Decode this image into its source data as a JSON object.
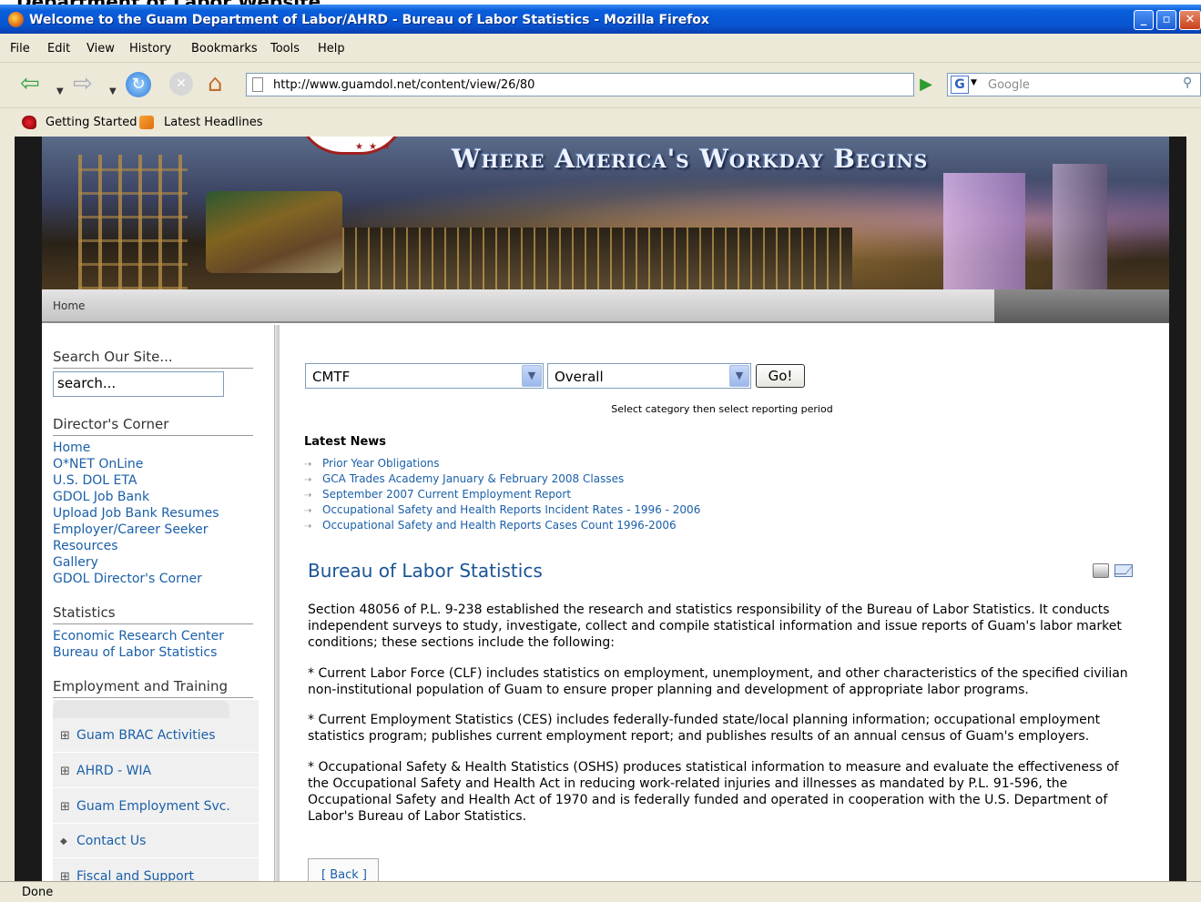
{
  "window": {
    "behind_title": "Department of Labor Website",
    "title": "Welcome to the Guam Department of Labor/AHRD - Bureau of Labor Statistics - Mozilla Firefox"
  },
  "menu": [
    "File",
    "Edit",
    "View",
    "History",
    "Bookmarks",
    "Tools",
    "Help"
  ],
  "toolbar": {
    "url": "http://www.guamdol.net/content/view/26/80",
    "search_placeholder": "Google"
  },
  "bookmarks": [
    "Getting Started",
    "Latest Headlines"
  ],
  "banner": {
    "slogan": "Where America's Workday Begins"
  },
  "breadcrumb": "Home",
  "sidebar": {
    "search_heading": "Search Our Site...",
    "search_value": "search...",
    "directors_heading": "Director's Corner",
    "directors_links": [
      "Home",
      "O*NET OnLine",
      "U.S. DOL ETA",
      "GDOL Job Bank",
      "Upload Job Bank Resumes",
      "Employer/Career Seeker",
      "Resources",
      "Gallery",
      "GDOL Director's Corner"
    ],
    "statistics_heading": "Statistics",
    "statistics_links": [
      "Economic Research Center",
      "Bureau of Labor Statistics"
    ],
    "employment_heading": "Employment and Training",
    "employment_menu": [
      {
        "marker": "⊞",
        "label": "Guam BRAC Activities"
      },
      {
        "marker": "⊞",
        "label": "AHRD - WIA"
      },
      {
        "marker": "⊞",
        "label": "Guam Employment Svc."
      },
      {
        "marker": "◆",
        "label": "Contact Us"
      },
      {
        "marker": "⊞",
        "label": "Fiscal and Support"
      }
    ]
  },
  "main": {
    "category_value": "CMTF",
    "period_value": "Overall",
    "go_label": "Go!",
    "hint": "Select category then select reporting period",
    "latest_news_heading": "Latest News",
    "news": [
      "Prior Year Obligations",
      "GCA Trades Academy January & February 2008 Classes",
      "September 2007 Current Employment Report",
      "Occupational Safety and Health Reports Incident Rates - 1996 - 2006",
      "Occupational Safety and Health Reports Cases Count 1996-2006"
    ],
    "article_title": "Bureau of Labor Statistics",
    "paragraphs": [
      "Section 48056 of P.L. 9-238 established the research and statistics responsibility of the Bureau of Labor Statistics. It conducts independent surveys to study, investigate, collect and compile statistical information and issue reports of Guam's labor market conditions; these sections include the following:",
      "* Current Labor Force (CLF) includes statistics on employment, unemployment, and other characteristics of the specified civilian non-institutional population of Guam to ensure proper planning and development of appropriate labor programs.",
      "* Current Employment Statistics (CES) includes federally-funded state/local planning information; occupational employment statistics program; publishes current employment report; and publishes results of an annual census of Guam's employers.",
      "* Occupational Safety & Health Statistics (OSHS) produces statistical information to measure and evaluate the effectiveness of the Occupational Safety and Health Act in reducing work-related injuries and illnesses as mandated by P.L. 91-596, the Occupational Safety and Health Act of 1970 and is federally funded and operated in cooperation with the U.S. Department of Labor's Bureau of Labor Statistics."
    ],
    "back_label": "[ Back ]"
  },
  "status": "Done"
}
